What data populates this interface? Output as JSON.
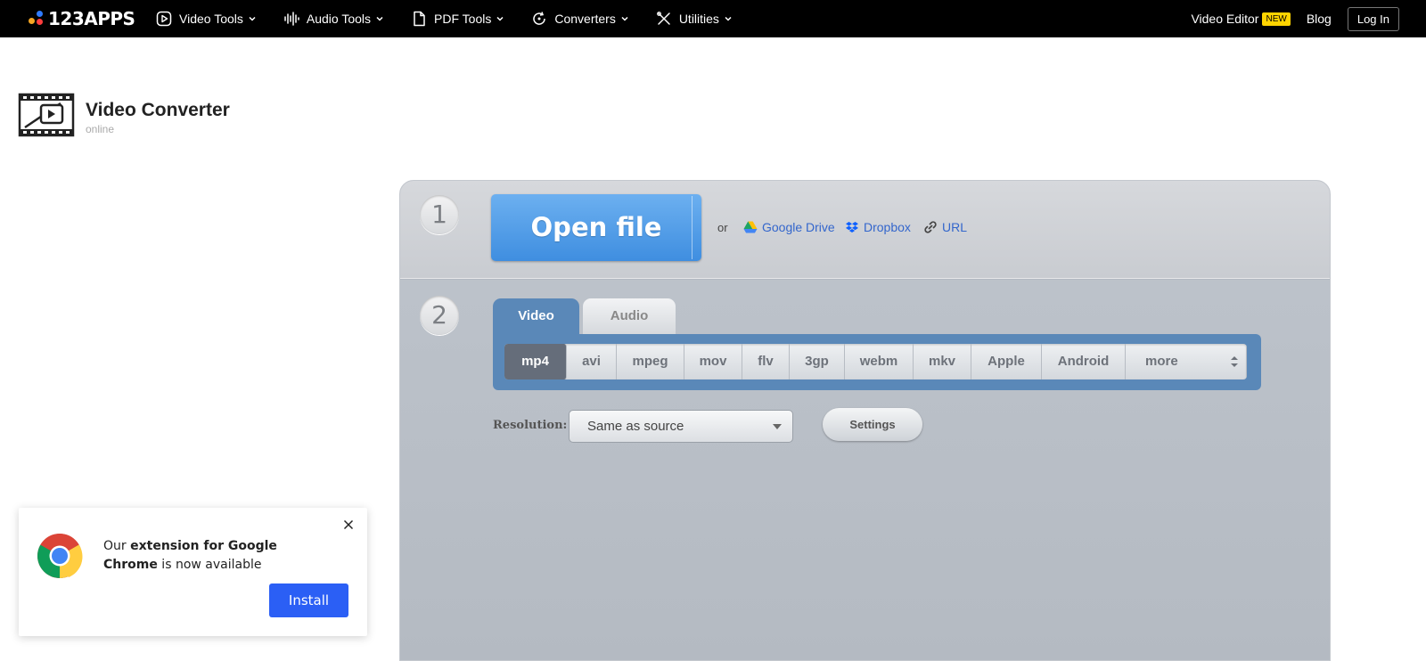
{
  "topbar": {
    "brand": "123APPS",
    "nav": [
      {
        "label": "Video Tools",
        "icon": "play-circle-icon"
      },
      {
        "label": "Audio Tools",
        "icon": "waveform-icon"
      },
      {
        "label": "PDF Tools",
        "icon": "document-icon"
      },
      {
        "label": "Converters",
        "icon": "refresh-icon"
      },
      {
        "label": "Utilities",
        "icon": "tools-icon"
      }
    ],
    "video_editor": "Video Editor",
    "new_badge": "NEW",
    "blog": "Blog",
    "login": "Log In"
  },
  "app": {
    "title": "Video Converter",
    "subtitle": "online"
  },
  "step1": {
    "number": "1",
    "open_file": "Open file",
    "or": "or",
    "google_drive": "Google Drive",
    "dropbox": "Dropbox",
    "url": "URL"
  },
  "step2": {
    "number": "2",
    "tabs": [
      "Video",
      "Audio"
    ],
    "active_tab": "Video",
    "formats": [
      "mp4",
      "avi",
      "mpeg",
      "mov",
      "flv",
      "3gp",
      "webm",
      "mkv",
      "Apple",
      "Android",
      "more"
    ],
    "active_format": "mp4",
    "resolution_label": "Resolution:",
    "resolution_value": "Same as source",
    "settings": "Settings"
  },
  "extension_popup": {
    "text_prefix": "Our ",
    "text_bold": "extension for Google Chrome",
    "text_suffix": " is now available",
    "install": "Install"
  },
  "colors": {
    "accent_blue": "#3f8ee0",
    "install_blue": "#2b5ff5",
    "format_bar": "#5a88b8",
    "badge_yellow": "#ffd400"
  }
}
